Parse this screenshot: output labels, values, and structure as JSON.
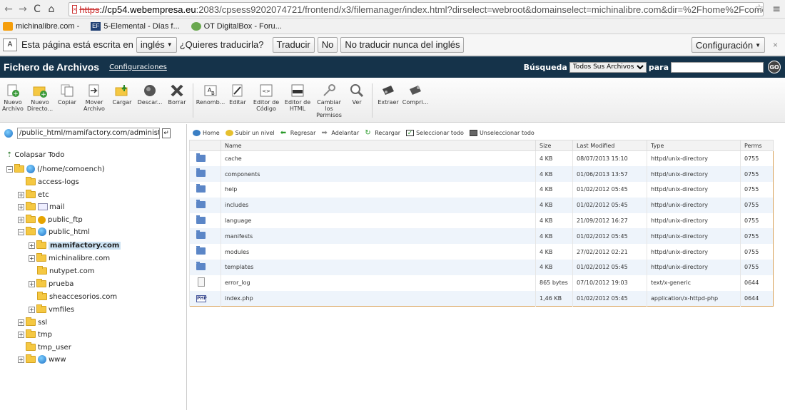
{
  "browser": {
    "url_https": "https",
    "url_domain": "://cp54.webempresa.eu",
    "url_rest": ":2083/cpsess9202074721/frontend/x3/filemanager/index.html?dirselect=webroot&domainselect=michinalibre.com&dir=%2Fhome%2Fcomoench%"
  },
  "bookmarks": [
    {
      "label": "michinalibre.com -"
    },
    {
      "label": "5-Elemental - Días f..."
    },
    {
      "label": "OT DigitalBox - Foru..."
    }
  ],
  "translate": {
    "prefix": "Esta página está escrita en",
    "language": "inglés",
    "question": "¿Quieres traducirla?",
    "translate_btn": "Traducir",
    "no_btn": "No",
    "never_btn": "No traducir nunca del inglés",
    "config_btn": "Configuración"
  },
  "header": {
    "title": "Fichero de Archivos",
    "config_link": "Configuraciones",
    "search_label": "Búsqueda",
    "search_scope": "Todos Sus Archivos",
    "search_para": "para",
    "go": "GO"
  },
  "toolbar": [
    {
      "label": "Nuevo Archivo"
    },
    {
      "label": "Nuevo Directo..."
    },
    {
      "label": "Copiar"
    },
    {
      "label": "Mover Archivo"
    },
    {
      "label": "Cargar"
    },
    {
      "label": "Descar..."
    },
    {
      "label": "Borrar"
    },
    {
      "label": "Renomb..."
    },
    {
      "label": "Editar"
    },
    {
      "label": "Editor de Código"
    },
    {
      "label": "Editor de HTML"
    },
    {
      "label": "Cambiar los Permisos"
    },
    {
      "label": "Ver"
    },
    {
      "label": "Extraer"
    },
    {
      "label": "Compri..."
    }
  ],
  "path": "/public_html/mamifactory.com/administr",
  "tree": {
    "collapse": "Colapsar Todo",
    "root": "(/home/comoench)",
    "items": [
      "access-logs",
      "etc",
      "mail",
      "public_ftp",
      "public_html",
      "mamifactory.com",
      "michinalibre.com",
      "nutypet.com",
      "prueba",
      "sheaccesorios.com",
      "vmfiles",
      "ssl",
      "tmp",
      "tmp_user",
      "www"
    ]
  },
  "nav": {
    "home": "Home",
    "up": "Subir un nivel",
    "back": "Regresar",
    "forward": "Adelantar",
    "reload": "Recargar",
    "select_all": "Seleccionar todo",
    "unselect_all": "Unseleccionar todo"
  },
  "table": {
    "headers": [
      "Name",
      "Size",
      "Last Modified",
      "Type",
      "Perms"
    ],
    "rows": [
      {
        "icon": "folder",
        "name": "cache",
        "size": "4 KB",
        "modified": "08/07/2013 15:10",
        "type": "httpd/unix-directory",
        "perms": "0755"
      },
      {
        "icon": "folder",
        "name": "components",
        "size": "4 KB",
        "modified": "01/06/2013 13:57",
        "type": "httpd/unix-directory",
        "perms": "0755"
      },
      {
        "icon": "folder",
        "name": "help",
        "size": "4 KB",
        "modified": "01/02/2012 05:45",
        "type": "httpd/unix-directory",
        "perms": "0755"
      },
      {
        "icon": "folder",
        "name": "includes",
        "size": "4 KB",
        "modified": "01/02/2012 05:45",
        "type": "httpd/unix-directory",
        "perms": "0755"
      },
      {
        "icon": "folder",
        "name": "language",
        "size": "4 KB",
        "modified": "21/09/2012 16:27",
        "type": "httpd/unix-directory",
        "perms": "0755"
      },
      {
        "icon": "folder",
        "name": "manifests",
        "size": "4 KB",
        "modified": "01/02/2012 05:45",
        "type": "httpd/unix-directory",
        "perms": "0755"
      },
      {
        "icon": "folder",
        "name": "modules",
        "size": "4 KB",
        "modified": "27/02/2012 02:21",
        "type": "httpd/unix-directory",
        "perms": "0755"
      },
      {
        "icon": "folder",
        "name": "templates",
        "size": "4 KB",
        "modified": "01/02/2012 05:45",
        "type": "httpd/unix-directory",
        "perms": "0755"
      },
      {
        "icon": "doc",
        "name": "error_log",
        "size": "865 bytes",
        "modified": "07/10/2012 19:03",
        "type": "text/x-generic",
        "perms": "0644"
      },
      {
        "icon": "php",
        "name": "index.php",
        "size": "1,46 KB",
        "modified": "01/02/2012 05:45",
        "type": "application/x-httpd-php",
        "perms": "0644"
      }
    ]
  }
}
